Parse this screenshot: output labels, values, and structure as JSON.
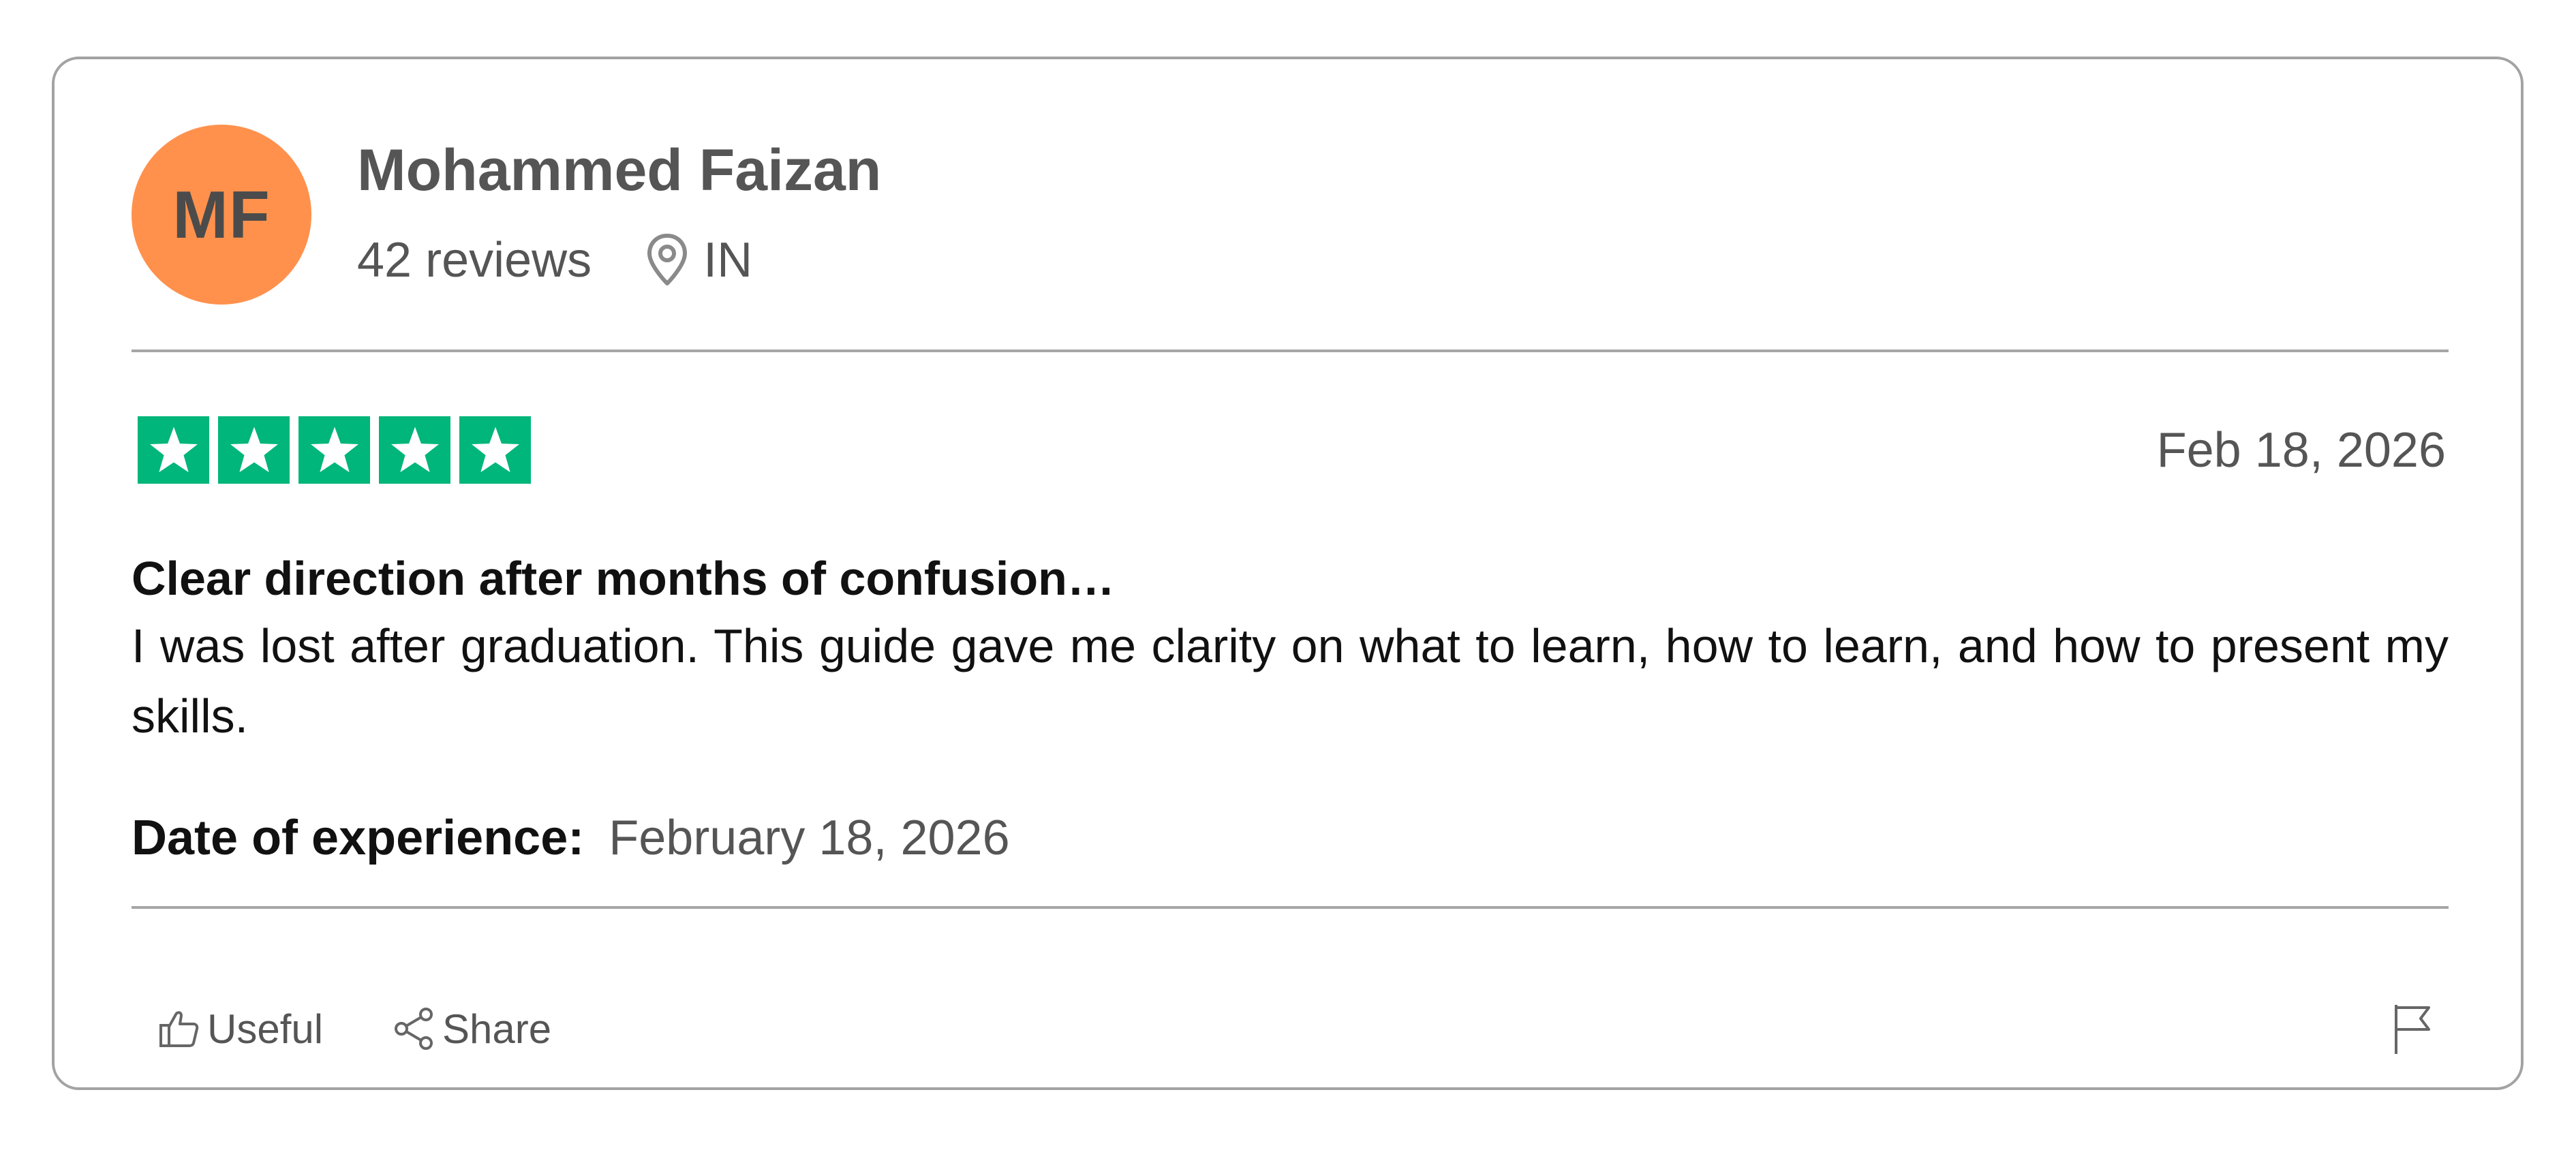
{
  "reviewer": {
    "initials": "MF",
    "avatar_color": "#ff914d",
    "name": "Mohammed Faizan",
    "review_count": "42 reviews",
    "location_icon": "location-pin-icon",
    "country": "IN"
  },
  "review": {
    "rating": 5,
    "rating_max": 5,
    "star_color": "#00b67a",
    "date": "Feb 18, 2026",
    "title": "Clear direction after months of confusion…",
    "body": "I was lost after graduation. This guide gave me clarity on what to learn, how to learn, and how to present my skills.",
    "experience_label": "Date of experience:",
    "experience_date": "February 18, 2026"
  },
  "actions": {
    "useful": {
      "label": "Useful",
      "icon": "thumbs-up-icon"
    },
    "share": {
      "label": "Share",
      "icon": "share-icon"
    },
    "report": {
      "icon": "flag-icon"
    }
  }
}
